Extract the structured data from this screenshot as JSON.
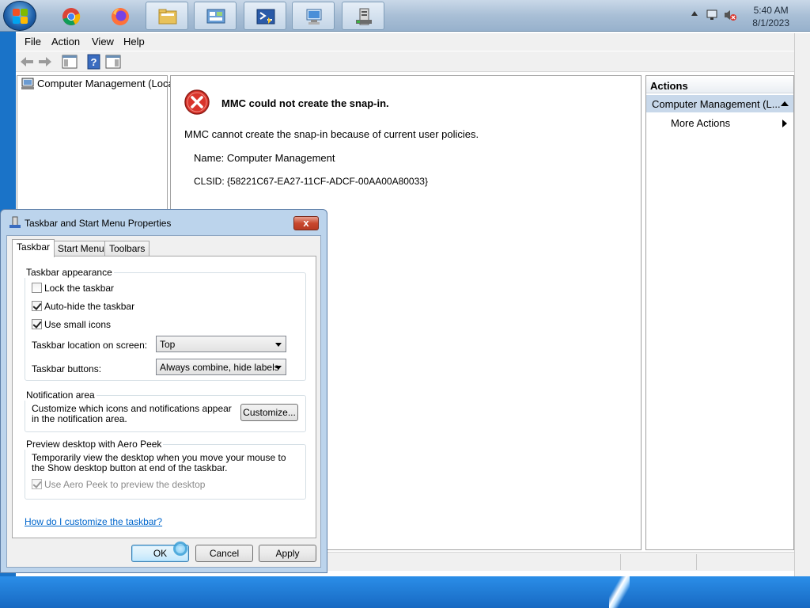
{
  "taskbar": {
    "apps": [
      {
        "name": "Google Chrome"
      },
      {
        "name": "Firefox"
      },
      {
        "name": "Windows Explorer"
      },
      {
        "name": "Control Panel"
      },
      {
        "name": "Windows PowerShell"
      },
      {
        "name": "Network"
      },
      {
        "name": "Computer Management"
      }
    ],
    "clock": {
      "time": "5:40 AM",
      "date": "8/1/2023"
    }
  },
  "mmc": {
    "menu": [
      "File",
      "Action",
      "View",
      "Help"
    ],
    "tree_root": "Computer Management (Local",
    "error": {
      "title": "MMC could not create the snap-in.",
      "message": "MMC cannot create the snap-in because of current user policies.",
      "name_line": "Name: Computer Management",
      "clsid_line": "CLSID: {58221C67-EA27-11CF-ADCF-00AA00A80033}"
    },
    "actions": {
      "header": "Actions",
      "section": "Computer Management (L...",
      "more_actions": "More Actions"
    }
  },
  "dialog": {
    "title": "Taskbar and Start Menu Properties",
    "close_glyph": "x",
    "tabs": [
      "Taskbar",
      "Start Menu",
      "Toolbars"
    ],
    "appearance": {
      "label": "Taskbar appearance",
      "lock": {
        "label": "Lock the taskbar",
        "checked": false
      },
      "autohide": {
        "label": "Auto-hide the taskbar",
        "checked": true
      },
      "small_icons": {
        "label": "Use small icons",
        "checked": true
      },
      "location_label": "Taskbar location on screen:",
      "location_value": "Top",
      "buttons_label": "Taskbar buttons:",
      "buttons_value": "Always combine, hide labels"
    },
    "notification": {
      "label": "Notification area",
      "text": "Customize which icons and notifications appear in the notification area.",
      "customize": "Customize..."
    },
    "aero": {
      "label": "Preview desktop with Aero Peek",
      "text": "Temporarily view the desktop when you move your mouse to the Show desktop button at end of the taskbar.",
      "checkbox": {
        "label": "Use Aero Peek to preview the desktop",
        "checked": true,
        "enabled": false
      }
    },
    "help_link": "How do I customize the taskbar?",
    "ok": "OK",
    "cancel": "Cancel",
    "apply": "Apply"
  },
  "colors": {
    "taskbar": "#a9bfd6",
    "desktop": "#1a73c8",
    "error_red": "#d9342b",
    "link": "#0066cc",
    "selection": "#c8d8ea"
  }
}
